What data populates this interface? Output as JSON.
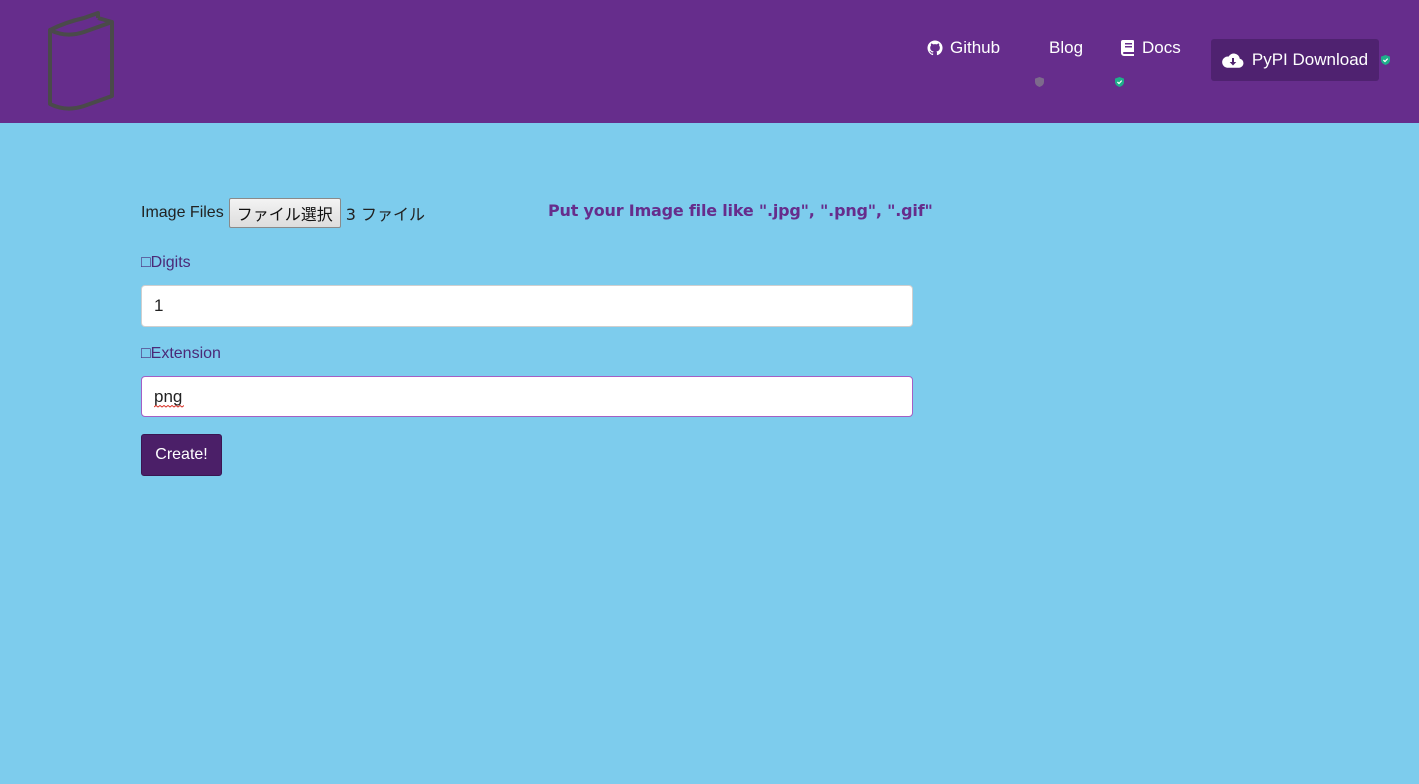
{
  "navbar": {
    "logo_icon": "book-icon",
    "links": [
      {
        "label": "Github",
        "icon": "github-icon"
      },
      {
        "label": "Blog"
      },
      {
        "label": "Docs",
        "icon": "book-icon"
      }
    ],
    "pypi": {
      "label": "PyPI Download",
      "icon": "cloud-download-icon"
    }
  },
  "form": {
    "file": {
      "label": "Image Files",
      "button": "ファイル選択",
      "status": "3 ファイル"
    },
    "hint": "Put your Image file like \".jpg\", \".png\", \".gif\"",
    "digits": {
      "label": "□Digits",
      "value": "1"
    },
    "extension": {
      "label": "□Extension",
      "value": "png"
    },
    "submit": "Create!"
  },
  "colors": {
    "navbar": "#662d8c",
    "background": "#7dcced",
    "button": "#4b1f68",
    "badge_green": "#1fae8a"
  }
}
